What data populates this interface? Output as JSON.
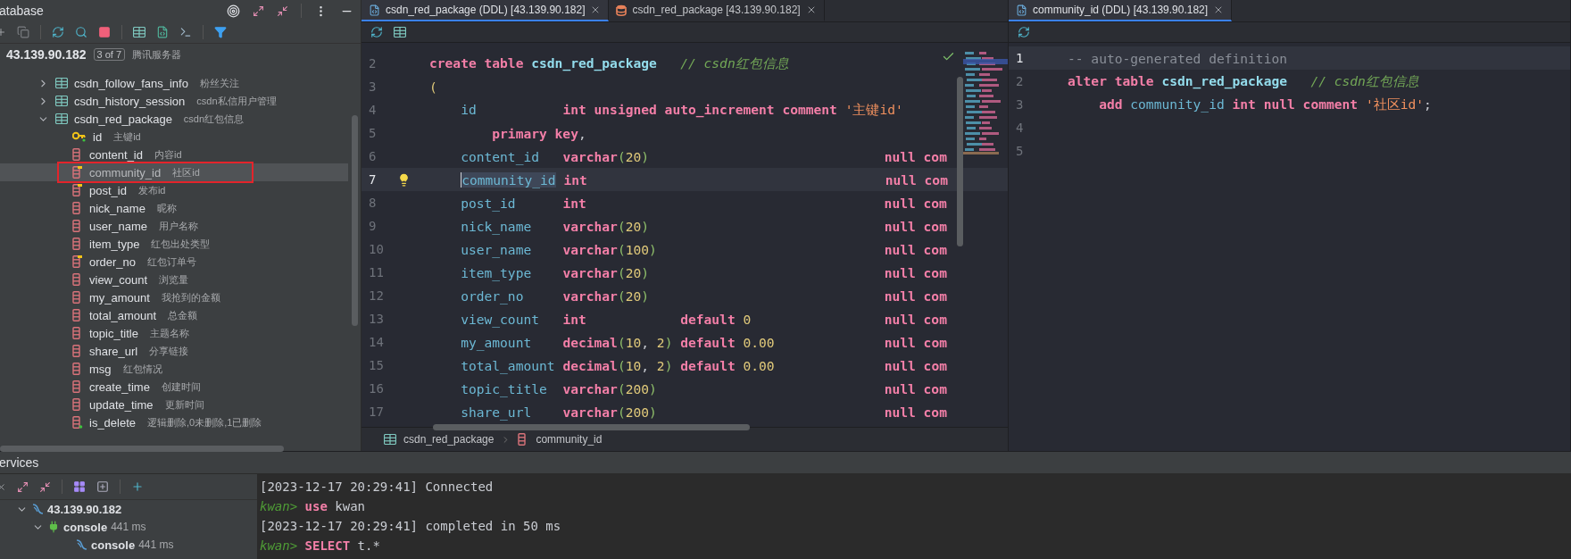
{
  "database_panel": {
    "title": "atabase",
    "server": {
      "host": "43.139.90.182",
      "badge": "3 of 7",
      "comment": "腾讯服务器"
    },
    "tree": [
      {
        "name": "csdn_follow_fans_info",
        "comment": "粉丝关注",
        "expanded": false
      },
      {
        "name": "csdn_history_session",
        "comment": "csdn私信用户管理",
        "expanded": false
      },
      {
        "name": "csdn_red_package",
        "comment": "csdn红包信息",
        "expanded": true,
        "children": [
          {
            "name": "id",
            "comment": "主键id",
            "kind": "primary_key",
            "selected": false,
            "highlighted": false
          },
          {
            "name": "content_id",
            "comment": "内容id",
            "kind": "column",
            "selected": false,
            "highlighted": false
          },
          {
            "name": "community_id",
            "comment": "社区id",
            "kind": "indexed_column",
            "selected": true,
            "highlighted": true
          },
          {
            "name": "post_id",
            "comment": "发布id",
            "kind": "indexed_column",
            "selected": false,
            "highlighted": false
          },
          {
            "name": "nick_name",
            "comment": "昵称",
            "kind": "column",
            "selected": false,
            "highlighted": false
          },
          {
            "name": "user_name",
            "comment": "用户名称",
            "kind": "column",
            "selected": false,
            "highlighted": false
          },
          {
            "name": "item_type",
            "comment": "红包出处类型",
            "kind": "column",
            "selected": false,
            "highlighted": false
          },
          {
            "name": "order_no",
            "comment": "红包订单号",
            "kind": "indexed_column",
            "selected": false,
            "highlighted": false
          },
          {
            "name": "view_count",
            "comment": "浏览量",
            "kind": "column",
            "selected": false,
            "highlighted": false
          },
          {
            "name": "my_amount",
            "comment": "我抢到的金额",
            "kind": "column",
            "selected": false,
            "highlighted": false
          },
          {
            "name": "total_amount",
            "comment": "总金额",
            "kind": "column",
            "selected": false,
            "highlighted": false
          },
          {
            "name": "topic_title",
            "comment": "主题名称",
            "kind": "column",
            "selected": false,
            "highlighted": false
          },
          {
            "name": "share_url",
            "comment": "分享链接",
            "kind": "column",
            "selected": false,
            "highlighted": false
          },
          {
            "name": "msg",
            "comment": "红包情况",
            "kind": "column",
            "selected": false,
            "highlighted": false
          },
          {
            "name": "create_time",
            "comment": "创建时间",
            "kind": "column",
            "selected": false,
            "highlighted": false
          },
          {
            "name": "update_time",
            "comment": "更新时间",
            "kind": "column",
            "selected": false,
            "highlighted": false
          },
          {
            "name": "is_delete",
            "comment": "逻辑删除,0未删除,1已删除",
            "kind": "flagged_column",
            "selected": false,
            "highlighted": false
          }
        ]
      }
    ]
  },
  "editor": {
    "tabs": [
      {
        "label": "csdn_red_package (DDL) [43.139.90.182]",
        "kind": "ddl",
        "selected": true
      },
      {
        "label": "csdn_red_package [43.139.90.182]",
        "kind": "data",
        "selected": false
      }
    ],
    "intention_bulb": true,
    "lines": [
      {
        "number": "2",
        "current": false,
        "tokens": [
          {
            "text": "create table ",
            "kind": "keyword"
          },
          {
            "text": "csdn_red_package",
            "kind": "table"
          },
          {
            "text": "   // csdn红包信息",
            "kind": "comment"
          }
        ]
      },
      {
        "number": "3",
        "current": false,
        "tokens": [
          {
            "text": "(",
            "kind": "number"
          }
        ]
      },
      {
        "number": "4",
        "current": false,
        "tokens": [
          {
            "text": "    id           ",
            "kind": "identifier"
          },
          {
            "text": "int unsigned auto_increment comment ",
            "kind": "keyword"
          },
          {
            "text": "'主键id'",
            "kind": "string"
          }
        ]
      },
      {
        "number": "5",
        "current": false,
        "tokens": [
          {
            "text": "        primary key",
            "kind": "keyword"
          },
          {
            "text": ",",
            "kind": "plain"
          }
        ]
      },
      {
        "number": "6",
        "current": false,
        "tokens": [
          {
            "text": "    content_id   ",
            "kind": "identifier"
          },
          {
            "text": "varchar",
            "kind": "keyword"
          },
          {
            "text": "(",
            "kind": "paren"
          },
          {
            "text": "20",
            "kind": "number"
          },
          {
            "text": ")                              ",
            "kind": "paren"
          },
          {
            "text": "null com",
            "kind": "keyword"
          }
        ]
      },
      {
        "number": "7",
        "current": true,
        "tokens": [
          {
            "text": "    community_id",
            "kind": "selection"
          },
          {
            "text": " int                                      ",
            "kind": "keyword"
          },
          {
            "text": "null com",
            "kind": "keyword"
          }
        ]
      },
      {
        "number": "8",
        "current": false,
        "tokens": [
          {
            "text": "    post_id      ",
            "kind": "identifier"
          },
          {
            "text": "int                                      ",
            "kind": "keyword"
          },
          {
            "text": "null com",
            "kind": "keyword"
          }
        ]
      },
      {
        "number": "9",
        "current": false,
        "tokens": [
          {
            "text": "    nick_name    ",
            "kind": "identifier"
          },
          {
            "text": "varchar",
            "kind": "keyword"
          },
          {
            "text": "(",
            "kind": "paren"
          },
          {
            "text": "20",
            "kind": "number"
          },
          {
            "text": ")                              ",
            "kind": "paren"
          },
          {
            "text": "null com",
            "kind": "keyword"
          }
        ]
      },
      {
        "number": "10",
        "current": false,
        "tokens": [
          {
            "text": "    user_name    ",
            "kind": "identifier"
          },
          {
            "text": "varchar",
            "kind": "keyword"
          },
          {
            "text": "(",
            "kind": "paren"
          },
          {
            "text": "100",
            "kind": "number"
          },
          {
            "text": ")                             ",
            "kind": "paren"
          },
          {
            "text": "null com",
            "kind": "keyword"
          }
        ]
      },
      {
        "number": "11",
        "current": false,
        "tokens": [
          {
            "text": "    item_type    ",
            "kind": "identifier"
          },
          {
            "text": "varchar",
            "kind": "keyword"
          },
          {
            "text": "(",
            "kind": "paren"
          },
          {
            "text": "20",
            "kind": "number"
          },
          {
            "text": ")                              ",
            "kind": "paren"
          },
          {
            "text": "null com",
            "kind": "keyword"
          }
        ]
      },
      {
        "number": "12",
        "current": false,
        "tokens": [
          {
            "text": "    order_no     ",
            "kind": "identifier"
          },
          {
            "text": "varchar",
            "kind": "keyword"
          },
          {
            "text": "(",
            "kind": "paren"
          },
          {
            "text": "20",
            "kind": "number"
          },
          {
            "text": ")                              ",
            "kind": "paren"
          },
          {
            "text": "null com",
            "kind": "keyword"
          }
        ]
      },
      {
        "number": "13",
        "current": false,
        "tokens": [
          {
            "text": "    view_count   ",
            "kind": "identifier"
          },
          {
            "text": "int            default ",
            "kind": "keyword"
          },
          {
            "text": "0                 ",
            "kind": "number"
          },
          {
            "text": "null com",
            "kind": "keyword"
          }
        ]
      },
      {
        "number": "14",
        "current": false,
        "tokens": [
          {
            "text": "    my_amount    ",
            "kind": "identifier"
          },
          {
            "text": "decimal",
            "kind": "keyword"
          },
          {
            "text": "(",
            "kind": "paren"
          },
          {
            "text": "10",
            "kind": "number"
          },
          {
            "text": ", ",
            "kind": "plain"
          },
          {
            "text": "2",
            "kind": "number"
          },
          {
            "text": ") ",
            "kind": "paren"
          },
          {
            "text": "default ",
            "kind": "keyword"
          },
          {
            "text": "0.00              ",
            "kind": "number"
          },
          {
            "text": "null com",
            "kind": "keyword"
          }
        ]
      },
      {
        "number": "15",
        "current": false,
        "tokens": [
          {
            "text": "    total_amount ",
            "kind": "identifier"
          },
          {
            "text": "decimal",
            "kind": "keyword"
          },
          {
            "text": "(",
            "kind": "paren"
          },
          {
            "text": "10",
            "kind": "number"
          },
          {
            "text": ", ",
            "kind": "plain"
          },
          {
            "text": "2",
            "kind": "number"
          },
          {
            "text": ") ",
            "kind": "paren"
          },
          {
            "text": "default ",
            "kind": "keyword"
          },
          {
            "text": "0.00              ",
            "kind": "number"
          },
          {
            "text": "null com",
            "kind": "keyword"
          }
        ]
      },
      {
        "number": "16",
        "current": false,
        "tokens": [
          {
            "text": "    topic_title  ",
            "kind": "identifier"
          },
          {
            "text": "varchar",
            "kind": "keyword"
          },
          {
            "text": "(",
            "kind": "paren"
          },
          {
            "text": "200",
            "kind": "number"
          },
          {
            "text": ")                             ",
            "kind": "paren"
          },
          {
            "text": "null com",
            "kind": "keyword"
          }
        ]
      },
      {
        "number": "17",
        "current": false,
        "tokens": [
          {
            "text": "    share_url    ",
            "kind": "identifier"
          },
          {
            "text": "varchar",
            "kind": "keyword"
          },
          {
            "text": "(",
            "kind": "paren"
          },
          {
            "text": "200",
            "kind": "number"
          },
          {
            "text": ")                             ",
            "kind": "paren"
          },
          {
            "text": "null com",
            "kind": "keyword"
          }
        ]
      }
    ],
    "breadcrumb": [
      "csdn_red_package",
      "community_id"
    ]
  },
  "ddl_panel": {
    "tabs": [
      {
        "label": "community_id (DDL) [43.139.90.182]",
        "kind": "ddl",
        "selected": true
      }
    ],
    "lines": [
      {
        "number": "1",
        "current": true,
        "tokens": [
          {
            "text": "-- auto-generated definition",
            "kind": "muted_comment"
          }
        ]
      },
      {
        "number": "2",
        "current": false,
        "tokens": [
          {
            "text": "alter table ",
            "kind": "keyword"
          },
          {
            "text": "csdn_red_package",
            "kind": "table"
          },
          {
            "text": "   // csdn红包信息",
            "kind": "comment"
          }
        ]
      },
      {
        "number": "3",
        "current": false,
        "tokens": [
          {
            "text": "    add ",
            "kind": "keyword"
          },
          {
            "text": "community_id ",
            "kind": "identifier"
          },
          {
            "text": "int null comment ",
            "kind": "keyword"
          },
          {
            "text": "'社区id'",
            "kind": "string"
          },
          {
            "text": ";",
            "kind": "plain"
          }
        ]
      },
      {
        "number": "4",
        "current": false
      },
      {
        "number": "5",
        "current": false
      }
    ]
  },
  "services": {
    "title": "ervices",
    "tree": [
      {
        "label": "43.139.90.182",
        "kind": "datasource",
        "expanded": true,
        "children": [
          {
            "label": "console",
            "time": "441 ms",
            "kind": "session",
            "expanded": true,
            "children": [
              {
                "label": "console",
                "time": "441 ms",
                "kind": "console"
              }
            ]
          }
        ]
      }
    ],
    "console": [
      {
        "tokens": [
          {
            "text": "[2023-12-17 20:29:41] Connected",
            "kind": "plain"
          }
        ]
      },
      {
        "tokens": [
          {
            "text": "kwan> ",
            "kind": "prompt"
          },
          {
            "text": "use",
            "kind": "keyword"
          },
          {
            "text": " kwan",
            "kind": "plain"
          }
        ]
      },
      {
        "tokens": [
          {
            "text": "[2023-12-17 20:29:41] completed in 50 ms",
            "kind": "plain"
          }
        ]
      },
      {
        "tokens": [
          {
            "text": "kwan> ",
            "kind": "prompt"
          },
          {
            "text": "SELECT",
            "kind": "keyword"
          },
          {
            "text": " t.*",
            "kind": "plain"
          }
        ]
      }
    ]
  }
}
